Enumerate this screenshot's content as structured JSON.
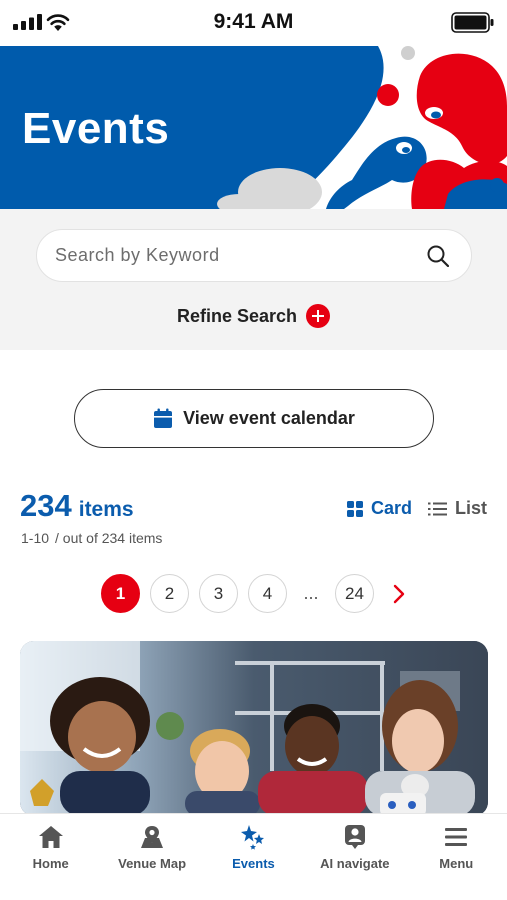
{
  "status_bar": {
    "time": "9:41 AM"
  },
  "hero": {
    "title": "Events"
  },
  "search": {
    "placeholder": "Search by Keyword",
    "value": ""
  },
  "refine": {
    "label": "Refine Search"
  },
  "calendar_button": {
    "label": "View event calendar"
  },
  "results": {
    "count": "234",
    "unit": "items",
    "range": "1-10",
    "total_text": "/  out of 234 items"
  },
  "view_toggle": {
    "card_label": "Card",
    "list_label": "List",
    "selected": "Card"
  },
  "pagination": {
    "pages": [
      "1",
      "2",
      "3",
      "4"
    ],
    "ellipsis": "...",
    "last": "24",
    "current": "1"
  },
  "bottom_nav": [
    {
      "label": "Home",
      "icon": "home-icon"
    },
    {
      "label": "Venue Map",
      "icon": "map-pin-icon"
    },
    {
      "label": "Events",
      "icon": "sparkle-stars-icon",
      "active": true
    },
    {
      "label": "AI navigate",
      "icon": "ai-person-icon"
    },
    {
      "label": "Menu",
      "icon": "menu-icon"
    }
  ],
  "colors": {
    "brand_blue": "#0b5cad",
    "accent_red": "#e60012",
    "hero_blue": "#005bac"
  }
}
